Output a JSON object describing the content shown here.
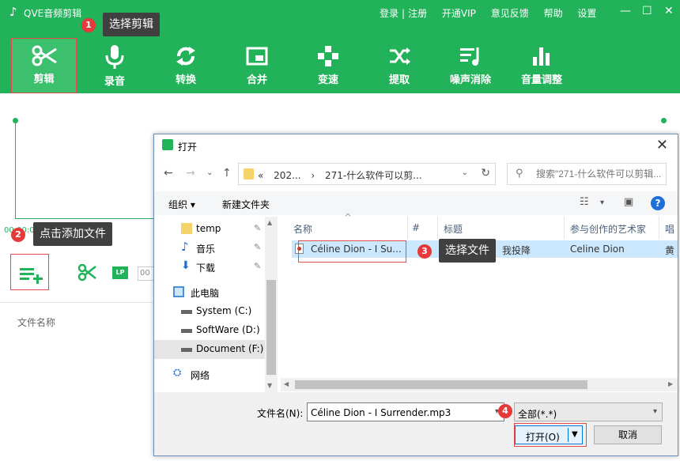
{
  "app": {
    "title": "QVE音频剪辑",
    "links": {
      "login": "登录",
      "separator": "|",
      "register": "注册",
      "vip": "开通VIP",
      "feedback": "意见反馈",
      "help": "帮助",
      "settings": "设置"
    },
    "window_controls": {
      "minimize": "—",
      "maximize": "☐",
      "close": "✕"
    }
  },
  "toolbar": {
    "items": [
      {
        "label": "剪辑",
        "icon": "scissors-icon"
      },
      {
        "label": "录音",
        "icon": "microphone-icon"
      },
      {
        "label": "转换",
        "icon": "convert-icon"
      },
      {
        "label": "合并",
        "icon": "merge-icon"
      },
      {
        "label": "变速",
        "icon": "speed-icon"
      },
      {
        "label": "提取",
        "icon": "extract-icon"
      },
      {
        "label": "噪声消除",
        "icon": "noise-icon"
      },
      {
        "label": "音量调整",
        "icon": "volume-icon"
      }
    ]
  },
  "editor": {
    "start_time": "00:00:00",
    "time_field": "00",
    "lp_label": "LP",
    "file_name_header": "文件名称"
  },
  "callouts": [
    {
      "number": "1",
      "text": "选择剪辑"
    },
    {
      "number": "2",
      "text": "点击添加文件"
    },
    {
      "number": "3",
      "text": "选择文件"
    },
    {
      "number": "4",
      "text": ""
    }
  ],
  "dialog": {
    "title": "打开",
    "close": "✕",
    "nav": {
      "back": "←",
      "forward": "→",
      "recent": "⌄",
      "up": "↑"
    },
    "address": {
      "prefix": "«",
      "crumb1": "202...",
      "crumb2": "271-什么软件可以剪...",
      "dropdown": "⌄",
      "refresh": "↻"
    },
    "search": {
      "placeholder": "搜索\"271-什么软件可以剪辑..."
    },
    "commands": {
      "organize": "组织 ▾",
      "new_folder": "新建文件夹",
      "view_dropdown": "▾"
    },
    "help": "?",
    "sidebar": [
      {
        "label": "temp",
        "icon": "folder-icon",
        "pinned": true
      },
      {
        "label": "音乐",
        "icon": "music-folder-icon",
        "pinned": true
      },
      {
        "label": "下载",
        "icon": "download-icon",
        "pinned": true
      },
      {
        "label": "此电脑",
        "icon": "computer-icon",
        "pinned": false
      },
      {
        "label": "System (C:)",
        "icon": "drive-icon",
        "pinned": false
      },
      {
        "label": "SoftWare (D:)",
        "icon": "drive-icon",
        "pinned": false
      },
      {
        "label": "Document (F:)",
        "icon": "drive-icon",
        "pinned": false,
        "selected": true
      },
      {
        "label": "网络",
        "icon": "network-icon",
        "pinned": false
      }
    ],
    "columns": {
      "name": "名称",
      "number": "#",
      "title": "标题",
      "artist": "参与创作的艺术家",
      "album": "唱"
    },
    "files": [
      {
        "name": "Céline Dion - I Su...",
        "title": "我投降",
        "artist": "Celine Dion",
        "album": "黄"
      }
    ],
    "file_name_label": "文件名(N):",
    "file_name_value": "Céline Dion - I Surrender.mp3",
    "filter_value": "全部(*.*)",
    "open_label": "打开(O)",
    "cancel_label": "取消"
  },
  "colors": {
    "brand": "#22b25a",
    "highlight": "#e24b4b",
    "badge": "#e63a3a",
    "selection": "#cce8ff"
  }
}
